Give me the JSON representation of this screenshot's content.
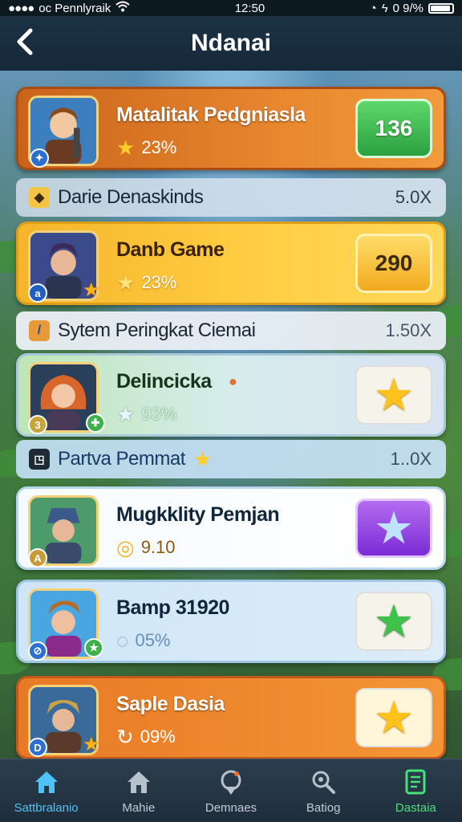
{
  "status_bar": {
    "carrier": "oc Pennlyraik",
    "time": "12:50",
    "battery_text": "0 9/%"
  },
  "header": {
    "title": "Ndanai"
  },
  "cards": [
    {
      "title": "Matalitak Pedgniasla",
      "sub_value": "23%",
      "button_value": "136",
      "badge": ""
    },
    {
      "title": "Danb Game",
      "sub_value": "23%",
      "button_value": "290",
      "badge": "a"
    },
    {
      "title": "Delincicka",
      "sub_value": "93%",
      "button_value": "",
      "badge": "3"
    },
    {
      "title": "Mugkklity Pemjan",
      "sub_value": "9.10",
      "button_value": "",
      "badge": "A"
    },
    {
      "title": "Bamp 31920",
      "sub_value": "05%",
      "button_value": "",
      "badge": ""
    },
    {
      "title": "Saple Dasia",
      "sub_value": "09%",
      "button_value": "",
      "badge": "D"
    }
  ],
  "sections": [
    {
      "label": "Darie Denaskinds",
      "value": "5.0X"
    },
    {
      "label": "Sytem Peringkat Ciemai",
      "value": "1.50X"
    },
    {
      "label": "Partva Pemmat",
      "value": "1..0X"
    }
  ],
  "tabs": [
    {
      "label": "Sattbralanio",
      "icon": "home-icon"
    },
    {
      "label": "Mahie",
      "icon": "house-icon"
    },
    {
      "label": "Demnaes",
      "icon": "location-icon"
    },
    {
      "label": "Batiog",
      "icon": "search-gear-icon"
    },
    {
      "label": "Dastaia",
      "icon": "document-icon"
    }
  ],
  "colors": {
    "accent_blue": "#4fc3f7",
    "accent_green": "#47e07a",
    "card_orange": "#e8862e",
    "card_yellow": "#ffcf45",
    "star_gold": "#ffb11a"
  }
}
